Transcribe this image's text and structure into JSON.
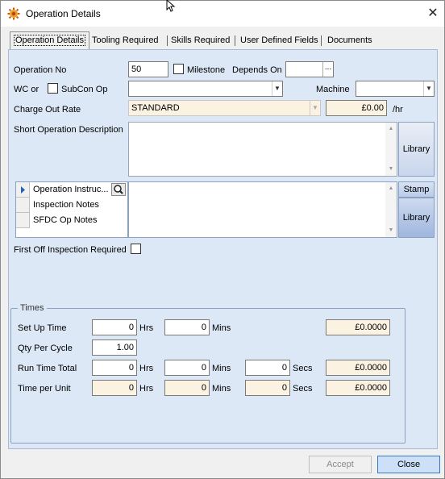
{
  "window": {
    "title": "Operation Details",
    "close_glyph": "✕"
  },
  "tabs": [
    {
      "label": "Operation Details"
    },
    {
      "label": "Tooling Required"
    },
    {
      "label": "Skills Required"
    },
    {
      "label": "User Defined Fields"
    },
    {
      "label": "Documents"
    }
  ],
  "form": {
    "operation_no_label": "Operation No",
    "operation_no_value": "50",
    "milestone_label": "Milestone",
    "depends_on_label": "Depends On",
    "depends_on_value": "",
    "ellipsis": "...",
    "wc_or_label": "WC or",
    "subcon_label": "SubCon Op",
    "wc_value": "",
    "machine_label": "Machine",
    "machine_value": "",
    "charge_rate_label": "Charge Out Rate",
    "charge_rate_value": "STANDARD",
    "charge_rate_amount": "£0.00",
    "per_hour": "/hr",
    "short_desc_label": "Short Operation Description",
    "short_desc_value": "",
    "library_label": "Library",
    "notes_items": [
      {
        "label": "Operation Instruc..."
      },
      {
        "label": "Inspection Notes"
      },
      {
        "label": "SFDC Op Notes"
      }
    ],
    "stamp_label": "Stamp",
    "notes_library_label": "Library",
    "first_off_label": "First Off Inspection Required"
  },
  "times": {
    "group_label": "Times",
    "hrs": "Hrs",
    "mins": "Mins",
    "secs": "Secs",
    "setup_label": "Set Up Time",
    "setup_hrs": "0",
    "setup_mins": "0",
    "setup_cost": "£0.0000",
    "qty_label": "Qty Per Cycle",
    "qty_value": "1.00",
    "run_label": "Run Time Total",
    "run_hrs": "0",
    "run_mins": "0",
    "run_secs": "0",
    "run_cost": "£0.0000",
    "unit_label": "Time per Unit",
    "unit_hrs": "0",
    "unit_mins": "0",
    "unit_secs": "0",
    "unit_cost": "£0.0000"
  },
  "buttons": {
    "accept": "Accept",
    "close": "Close"
  },
  "colors": {
    "panel_bg": "#dde8f6",
    "readonly_bg": "#fcf2e1",
    "primary_button": "#cce0f7"
  }
}
